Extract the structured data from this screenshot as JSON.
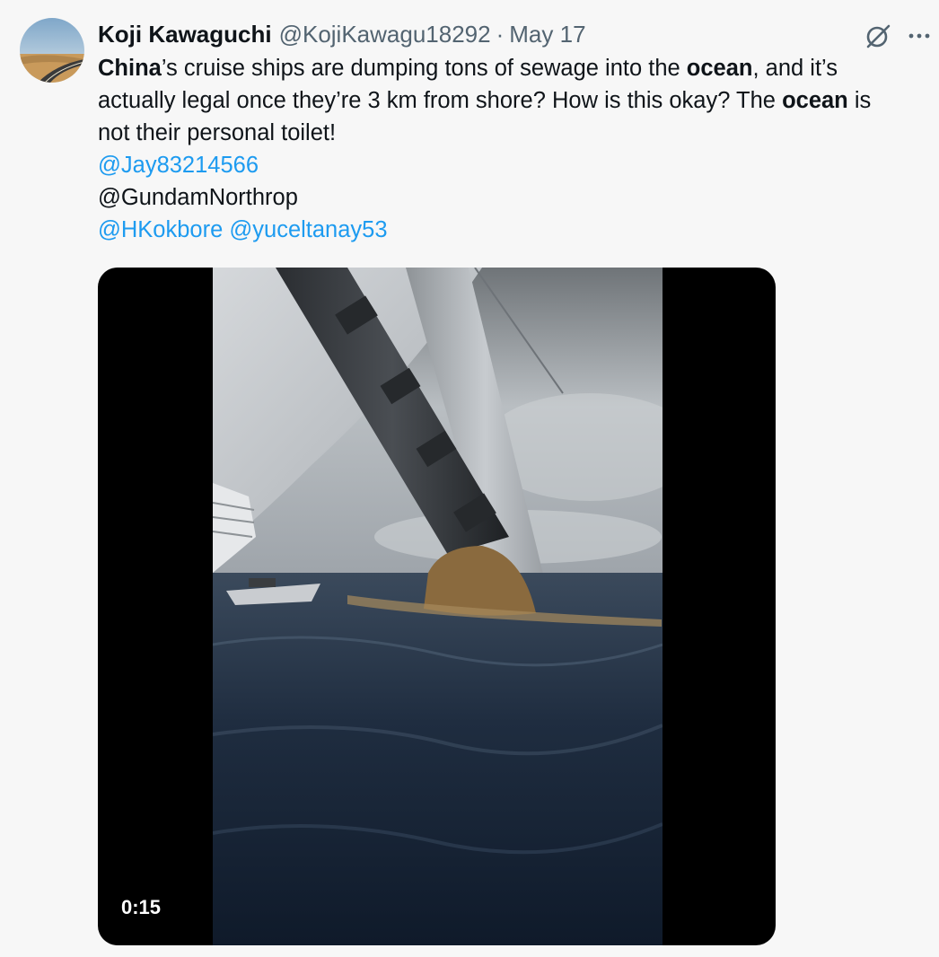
{
  "author": {
    "display_name": "Koji Kawaguchi",
    "handle": "@KojiKawagu18292",
    "separator": "·",
    "date": "May 17"
  },
  "icons": {
    "avatar": "avatar-road-landscape",
    "grok": "grok-icon",
    "more": "more-dots-icon"
  },
  "body": {
    "line1": {
      "china": "China",
      "t1": "’s cruise ships are dumping tons of sewage into the ",
      "ocean": "ocean",
      "t2": ", and it’s"
    },
    "line2": {
      "t1": "actually legal once they’re 3 km from shore? How is this okay? The ",
      "ocean": "ocean",
      "t2": " is"
    },
    "line3": "not their personal toilet!",
    "mentions": {
      "m1": "@Jay83214566",
      "m2": "@GundamNorthrop",
      "m3": "@HKokbore",
      "m4": "@yuceltanay53"
    }
  },
  "media": {
    "type": "video",
    "duration": "0:15"
  },
  "colors": {
    "link": "#1d9bf0",
    "secondary_text": "#536471",
    "background": "#f7f7f7"
  }
}
